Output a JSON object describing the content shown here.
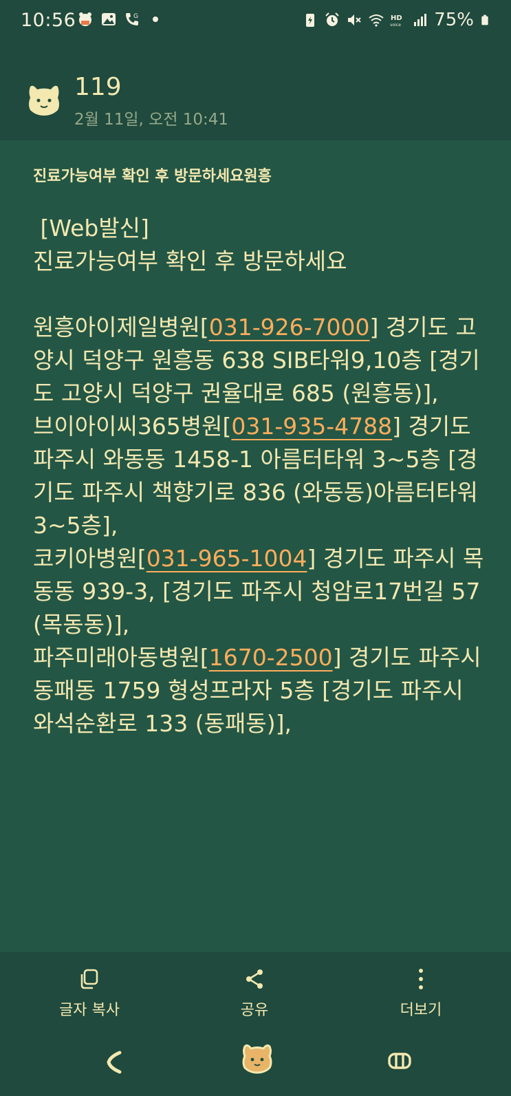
{
  "status_bar": {
    "time": "10:56",
    "battery": "75%",
    "left_icons": [
      "bear-app-icon",
      "gallery-icon",
      "call-forward-icon",
      "dot-icon"
    ],
    "right_icons": [
      "battery-saver-icon",
      "alarm-icon",
      "mute-icon",
      "wifi-icon",
      "hd-voice-icon",
      "signal-icon",
      "battery-icon"
    ]
  },
  "header": {
    "sender": "119",
    "datetime": "2월 11일, 오전 10:41"
  },
  "message": {
    "subject": "진료가능여부 확인 후 방문하세요원흥",
    "intro": " [Web발신]\n진료가능여부 확인 후 방문하세요\n\n",
    "hospitals": [
      {
        "name": "원흥아이제일병원",
        "phone": "031-926-7000",
        "address": "경기도 고양시 덕양구 원흥동 638 SIB타워9,10층 [경기도 고양시 덕양구 권율대로 685 (원흥동)],"
      },
      {
        "name": "브이아이씨365병원",
        "phone": "031-935-4788",
        "address": "경기도 파주시 와동동 1458-1 아름터타워 3~5층 [경기도 파주시 책향기로 836 (와동동)아름터타워 3~5층],"
      },
      {
        "name": "코키아병원",
        "phone": "031-965-1004",
        "address": "경기도 파주시 목동동 939-3, [경기도 파주시 청암로17번길 57 (목동동)],"
      },
      {
        "name": "파주미래아동병원",
        "phone": "1670-2500",
        "address": "경기도 파주시 동패동 1759 형성프라자 5층 [경기도 파주시 와석순환로 133 (동패동)],"
      }
    ]
  },
  "actions": {
    "copy": "글자 복사",
    "share": "공유",
    "more": "더보기"
  },
  "colors": {
    "background": "#1f4a3d",
    "content_background": "#235645",
    "text": "#f3e8b0",
    "phone_link": "#ffad5c"
  }
}
